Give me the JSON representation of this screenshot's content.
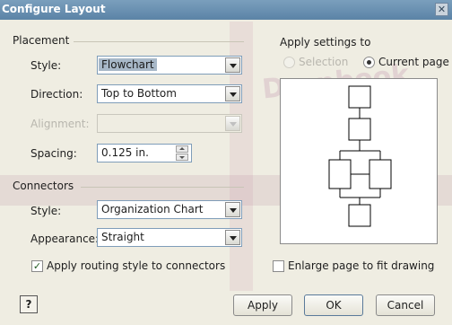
{
  "window": {
    "title": "Configure Layout",
    "close_glyph": "✕"
  },
  "watermark": "Dropbook",
  "placement": {
    "header": "Placement",
    "style": {
      "label": "Style:",
      "value": "Flowchart"
    },
    "direction": {
      "label": "Direction:",
      "value": "Top to Bottom"
    },
    "alignment": {
      "label": "Alignment:",
      "value": ""
    },
    "spacing": {
      "label": "Spacing:",
      "value": "0.125 in."
    }
  },
  "connectors": {
    "header": "Connectors",
    "style": {
      "label": "Style:",
      "value": "Organization Chart"
    },
    "appearance": {
      "label": "Appearance:",
      "value": "Straight"
    },
    "routing_checkbox": {
      "label": "Apply routing style to connectors",
      "checked": true
    }
  },
  "apply_settings": {
    "header": "Apply settings to",
    "selection_label": "Selection",
    "current_page_label": "Current page",
    "selected": "current_page"
  },
  "enlarge_checkbox": {
    "label": "Enlarge page to fit drawing",
    "checked": false
  },
  "buttons": {
    "help": "?",
    "apply": "Apply",
    "ok": "OK",
    "cancel": "Cancel"
  },
  "check_glyph": "✓"
}
